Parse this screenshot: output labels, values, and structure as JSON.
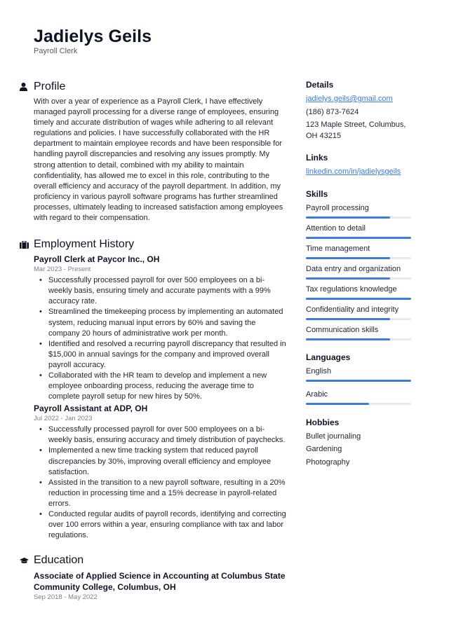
{
  "header": {
    "name": "Jadielys Geils",
    "title": "Payroll Clerk"
  },
  "profile": {
    "heading": "Profile",
    "icon": "person-icon",
    "text": "With over a year of experience as a Payroll Clerk, I have effectively managed payroll processing for a diverse range of employees, ensuring timely and accurate distribution of wages while adhering to all relevant regulations and policies. I have successfully collaborated with the HR department to maintain employee records and have been responsible for handling payroll discrepancies and resolving any issues promptly. My strong attention to detail, combined with my ability to maintain confidentiality, has allowed me to excel in this role, contributing to the overall efficiency and accuracy of the payroll department. In addition, my proficiency in various payroll software programs has further streamlined processes, ultimately leading to increased satisfaction among employees with regard to their compensation."
  },
  "employment": {
    "heading": "Employment History",
    "icon": "briefcase-icon",
    "jobs": [
      {
        "title": "Payroll Clerk at Paycor Inc., OH",
        "date": "Mar 2023 - Present",
        "bullets": [
          "Successfully processed payroll for over 500 employees on a bi-weekly basis, ensuring timely and accurate payments with a 99% accuracy rate.",
          "Streamlined the timekeeping process by implementing an automated system, reducing manual input errors by 60% and saving the company 20 hours of administrative work per month.",
          "Identified and resolved a recurring payroll discrepancy that resulted in $15,000 in annual savings for the company and improved overall payroll accuracy.",
          "Collaborated with the HR team to develop and implement a new employee onboarding process, reducing the average time to complete payroll setup for new hires by 50%."
        ]
      },
      {
        "title": "Payroll Assistant at ADP, OH",
        "date": "Jul 2022 - Jan 2023",
        "bullets": [
          "Successfully processed payroll for over 500 employees on a bi-weekly basis, ensuring accuracy and timely distribution of paychecks.",
          "Implemented a new time tracking system that reduced payroll discrepancies by 30%, improving overall efficiency and employee satisfaction.",
          "Assisted in the transition to a new payroll software, resulting in a 20% reduction in processing time and a 15% decrease in payroll-related errors.",
          "Conducted regular audits of payroll records, identifying and correcting over 100 errors within a year, ensuring compliance with tax and labor regulations."
        ]
      }
    ]
  },
  "education": {
    "heading": "Education",
    "icon": "graduation-cap-icon",
    "items": [
      {
        "title": "Associate of Applied Science in Accounting at Columbus State Community College, Columbus, OH",
        "date": "Sep 2018 - May 2022"
      }
    ]
  },
  "details": {
    "heading": "Details",
    "email": "jadielys.geils@gmail.com",
    "phone": "(186) 873-7624",
    "address": "123 Maple Street, Columbus, OH 43215"
  },
  "links": {
    "heading": "Links",
    "items": [
      "linkedin.com/in/jadielysgeils"
    ]
  },
  "skills": {
    "heading": "Skills",
    "items": [
      {
        "label": "Payroll processing",
        "level": 0.8
      },
      {
        "label": "Attention to detail",
        "level": 1.0
      },
      {
        "label": "Time management",
        "level": 0.8
      },
      {
        "label": "Data entry and organization",
        "level": 0.8
      },
      {
        "label": "Tax regulations knowledge",
        "level": 1.0
      },
      {
        "label": "Confidentiality and integrity",
        "level": 0.8
      },
      {
        "label": "Communication skills",
        "level": 0.8
      }
    ]
  },
  "languages": {
    "heading": "Languages",
    "items": [
      {
        "label": "English",
        "level": 1.0
      },
      {
        "label": "Arabic",
        "level": 0.6
      }
    ]
  },
  "hobbies": {
    "heading": "Hobbies",
    "items": [
      "Bullet journaling",
      "Gardening",
      "Photography"
    ]
  },
  "colors": {
    "accent": "#3d7be0",
    "text": "#1f2230",
    "muted": "#7a7f8a"
  }
}
